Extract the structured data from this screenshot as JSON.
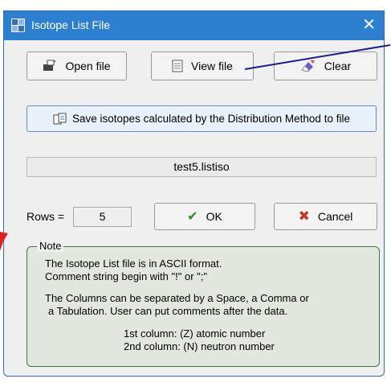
{
  "window": {
    "title": "Isotope List File"
  },
  "toolbar": {
    "open_label": "Open file",
    "view_label": "View file",
    "clear_label": "Clear"
  },
  "save_button": {
    "label": "Save isotopes calculated by the Distribution Method to file"
  },
  "file": {
    "name": "test5.listiso"
  },
  "rows": {
    "label": "Rows =",
    "value": "5"
  },
  "actions": {
    "ok_label": "OK",
    "cancel_label": "Cancel"
  },
  "note": {
    "title": "Note",
    "lines": [
      "The Isotope List file is in ASCII format.",
      "Comment string begin with \"!\"  or \";\"",
      "The Columns can be separated by a Space, a Comma or",
      "a Tabulation. User can put comments  after the data.",
      "1st column:  (Z)  atomic number",
      "2nd column: (N)  neutron number"
    ]
  },
  "colors": {
    "titlebar": "#2d7fcf",
    "ok_check": "#2e8b2e",
    "cancel_x": "#c0392b",
    "note_border": "#3c7a3c",
    "pointer": "#1d1d8f",
    "edge_mark": "#e02020"
  }
}
